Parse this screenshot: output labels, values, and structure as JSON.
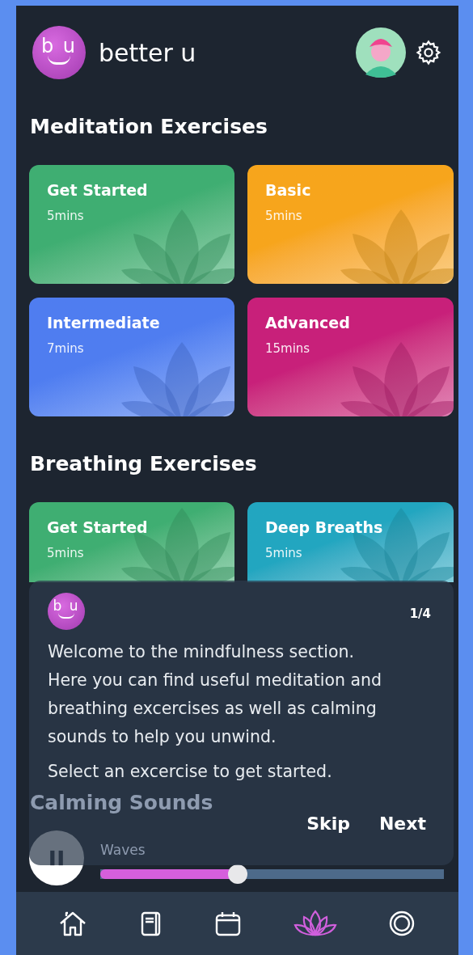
{
  "header": {
    "logo_text": "b u",
    "brand": "better u"
  },
  "sections": [
    {
      "title": "Meditation Exercises",
      "cards": [
        {
          "title": "Get Started",
          "duration": "5mins",
          "color": "#3fae72"
        },
        {
          "title": "Basic",
          "duration": "5mins",
          "color": "#f7a51c"
        },
        {
          "title": "Intermediate",
          "duration": "7mins",
          "color": "#4f7df0"
        },
        {
          "title": "Advanced",
          "duration": "15mins",
          "color": "#c8207a"
        }
      ]
    },
    {
      "title": "Breathing Exercises",
      "cards": [
        {
          "title": "Get Started",
          "duration": "5mins",
          "color": "#3fae72"
        },
        {
          "title": "Deep Breaths",
          "duration": "5mins",
          "color": "#22a6c0"
        }
      ]
    }
  ],
  "calming_sounds": {
    "title": "Calming Sounds",
    "track": "Waves",
    "playing": true,
    "level": 0.4
  },
  "coach_mark": {
    "logo_text": "b u",
    "step": "1/4",
    "message": "Welcome to the mindfulness section. Here you can find useful meditation and breathing excercises as well as calming sounds to help you unwind.",
    "hint": "Select an excercise to get started.",
    "buttons": [
      "Skip",
      "Next"
    ]
  },
  "nav": [
    {
      "kind": "home",
      "selected": false
    },
    {
      "kind": "journal",
      "selected": false
    },
    {
      "kind": "calendar",
      "selected": false
    },
    {
      "kind": "lotus",
      "selected": true
    },
    {
      "kind": "lifebuoy",
      "selected": false
    }
  ]
}
